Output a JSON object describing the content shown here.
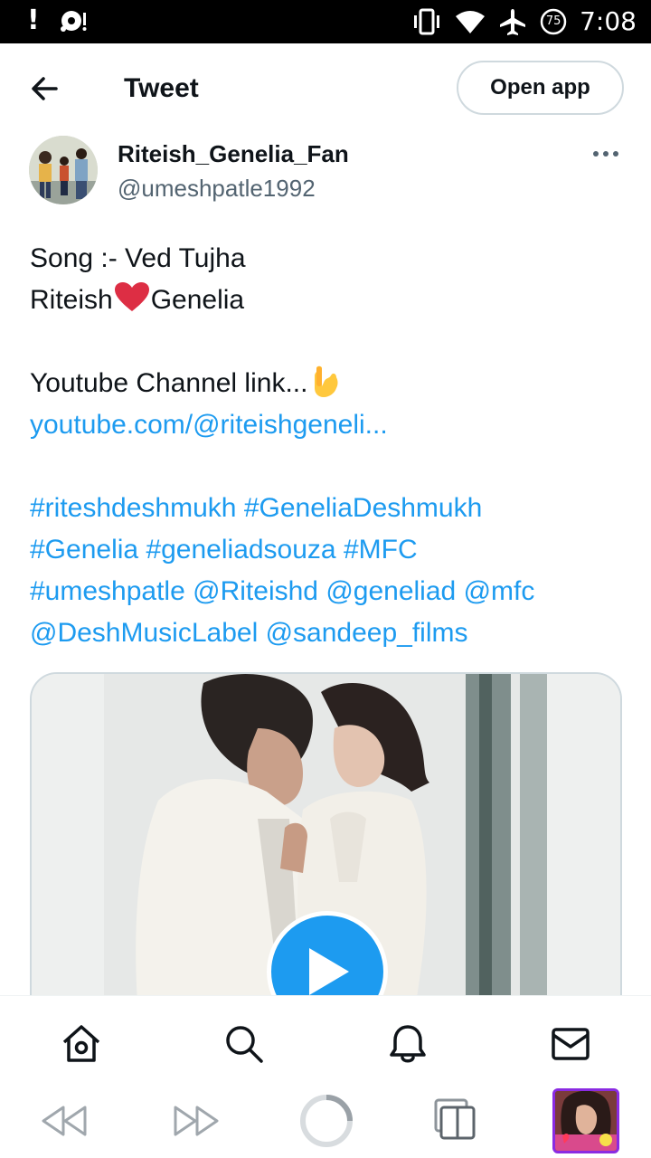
{
  "status_bar": {
    "time": "7:08",
    "battery_level": "75",
    "icons": [
      "alert-icon",
      "media-icon",
      "vibrate-icon",
      "wifi-icon",
      "airplane-icon",
      "battery-icon"
    ]
  },
  "header": {
    "title": "Tweet",
    "open_app_label": "Open app",
    "back_icon": "arrow-left-icon"
  },
  "author": {
    "name": "Riteish_Genelia_Fan",
    "handle": "@umeshpatle1992"
  },
  "tweet": {
    "line1": "Song :- Ved Tujha",
    "line2_a": "Riteish",
    "line2_b": "Genelia",
    "line3": "Youtube Channel link...",
    "link": "youtube.com/@riteishgeneli...",
    "tags_line1_a": "#riteshdeshmukh",
    "tags_line1_b": "#GeneliaDeshmukh",
    "tags_line2_a": "#Genelia",
    "tags_line2_b": "#geneliadsouza",
    "tags_line2_c": "#MFC",
    "tags_line3_a": "#umeshpatle",
    "tags_line3_b": "@Riteishd",
    "tags_line3_c": "@geneliad",
    "tags_line3_d": "@mfc",
    "tags_line4_a": "@DeshMusicLabel",
    "tags_line4_b": "@sandeep_films"
  },
  "colors": {
    "accent": "#1d9bf0",
    "text": "#0f1419",
    "secondary": "#536471",
    "border": "#cfd9de"
  },
  "bottom_nav": {
    "items": [
      "home-icon",
      "search-icon",
      "notifications-icon",
      "messages-icon"
    ]
  },
  "browser_bar": {
    "items": [
      "rewind-icon",
      "fast-forward-icon",
      "loading-icon",
      "tabs-icon",
      "tab-thumbnail"
    ]
  }
}
